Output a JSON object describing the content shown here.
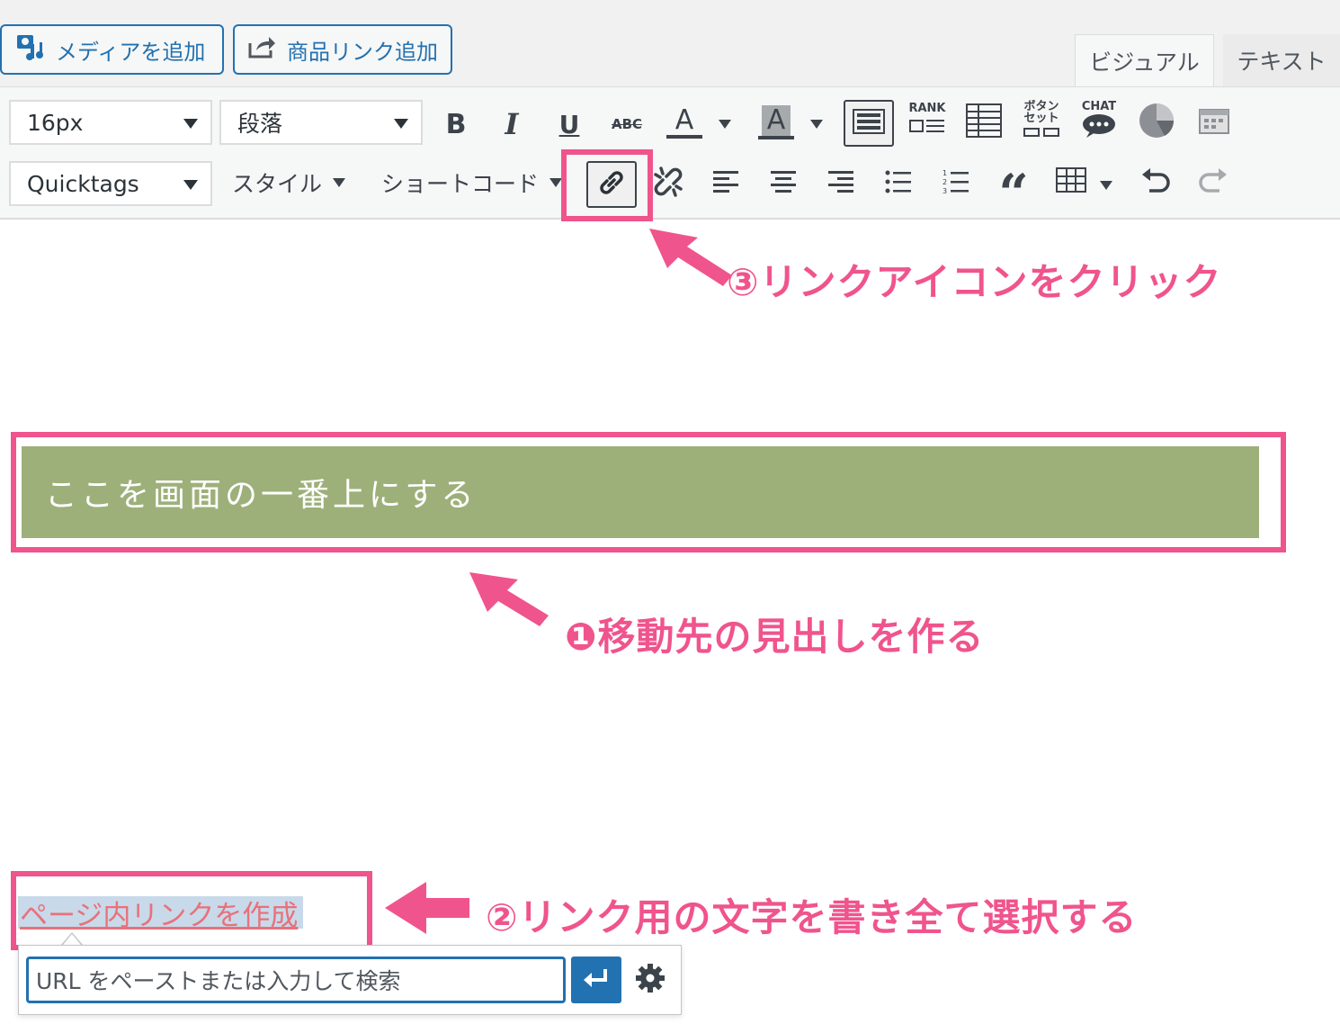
{
  "header": {
    "add_media_label": "メディアを追加",
    "add_product_link_label": "商品リンク追加",
    "tabs": [
      {
        "label": "ビジュアル",
        "active": true
      },
      {
        "label": "テキスト",
        "active": false
      }
    ]
  },
  "toolbar": {
    "font_size_select": "16px",
    "format_select": "段落",
    "quicktags_select": "Quicktags",
    "style_menu": "スタイル",
    "shortcode_menu": "ショートコード",
    "bold_glyph": "B",
    "italic_glyph": "I",
    "underline_glyph": "U",
    "strike_glyph": "ABC",
    "text_color_glyph": "A",
    "bg_color_glyph": "A",
    "rank_label": "RANK",
    "button_set_label_1": "ボタン",
    "button_set_label_2": "セット",
    "chat_label": "CHAT",
    "quote_glyph": "“"
  },
  "annotations": {
    "step3": "③リンクアイコンをクリック",
    "step1": "❶移動先の見出しを作る",
    "step2": "②リンク用の文字を書き全て選択する"
  },
  "content": {
    "heading_text": "ここを画面の一番上にする",
    "selected_link_text": "ページ内リンクを作成"
  },
  "link_popup": {
    "url_placeholder": "URL をペーストまたは入力して検索"
  },
  "colors": {
    "accent_pink": "#f0548c",
    "heading_bg": "#9eb07a",
    "wp_blue": "#2271b1"
  }
}
